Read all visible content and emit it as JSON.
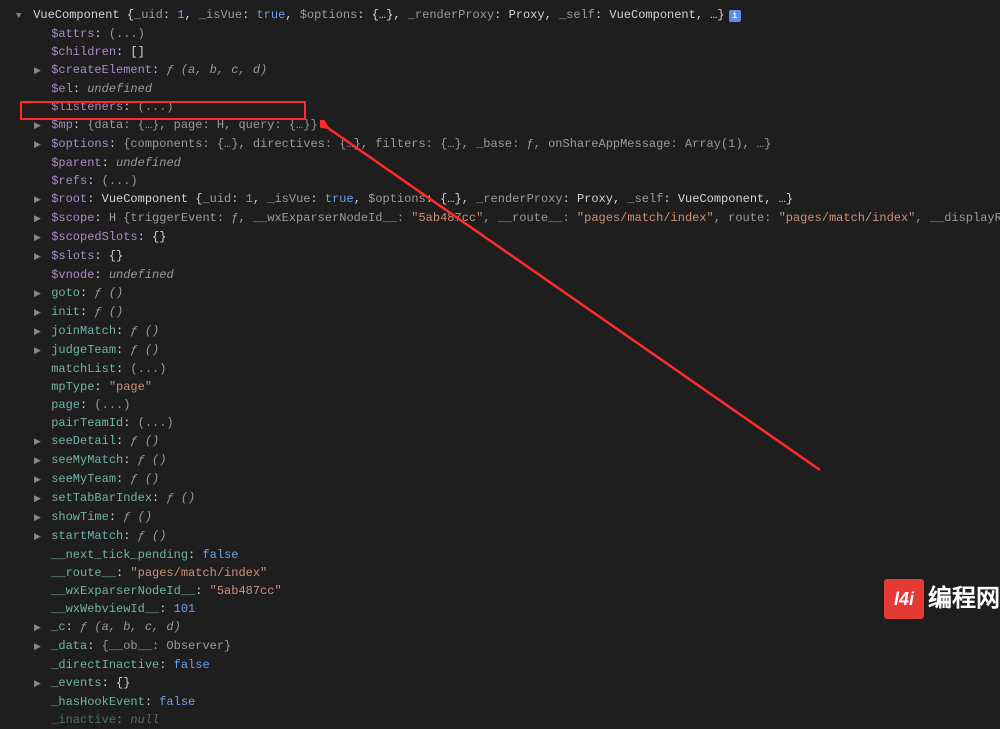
{
  "header": {
    "name": "VueComponent",
    "detail_parts": [
      {
        "k": "_uid",
        "v": "1",
        "t": "num"
      },
      {
        "k": "_isVue",
        "v": "true",
        "t": "bool"
      },
      {
        "k": "$options",
        "v": "{…}",
        "t": "obj"
      },
      {
        "k": "_renderProxy",
        "v": "Proxy",
        "t": "cls"
      },
      {
        "k": "_self",
        "v": "VueComponent",
        "t": "cls"
      }
    ],
    "trail": ", …}"
  },
  "rows": [
    {
      "tri": "none",
      "name": "$attrs",
      "nclass": "prop-purple",
      "val": "(...)",
      "vclass": "gray"
    },
    {
      "tri": "none",
      "name": "$children",
      "nclass": "prop-purple",
      "val": "[]",
      "vclass": "punct"
    },
    {
      "tri": "closed",
      "name": "$createElement",
      "nclass": "prop-purple",
      "fn": "(a, b, c, d)"
    },
    {
      "tri": "none",
      "name": "$el",
      "nclass": "prop-purple",
      "val": "undefined",
      "vclass": "kw-italic"
    },
    {
      "tri": "none",
      "name": "$listeners",
      "nclass": "prop-purple",
      "val": "(...)",
      "vclass": "gray",
      "highlight_cut": true
    },
    {
      "tri": "closed",
      "name": "$mp",
      "nclass": "prop-purple",
      "raw": "{data: {…}, page: H, query: {…}}",
      "highlight": true
    },
    {
      "tri": "closed",
      "name": "$options",
      "nclass": "prop-purple",
      "raw": "{components: {…}, directives: {…}, filters: {…}, _base: ƒ, onShareAppMessage: Array(1), …}"
    },
    {
      "tri": "none",
      "name": "$parent",
      "nclass": "prop-purple",
      "val": "undefined",
      "vclass": "kw-italic"
    },
    {
      "tri": "none",
      "name": "$refs",
      "nclass": "prop-purple",
      "val": "(...)",
      "vclass": "gray"
    },
    {
      "tri": "closed",
      "name": "$root",
      "nclass": "prop-purple",
      "raw_root": true
    },
    {
      "tri": "closed",
      "name": "$scope",
      "nclass": "prop-purple",
      "scope": true
    },
    {
      "tri": "closed",
      "name": "$scopedSlots",
      "nclass": "prop-purple",
      "val": "{}",
      "vclass": "punct"
    },
    {
      "tri": "closed",
      "name": "$slots",
      "nclass": "prop-purple",
      "val": "{}",
      "vclass": "punct"
    },
    {
      "tri": "none",
      "name": "$vnode",
      "nclass": "prop-purple",
      "val": "undefined",
      "vclass": "kw-italic"
    },
    {
      "tri": "closed",
      "name": "goto",
      "nclass": "prop-teal",
      "fn": "()"
    },
    {
      "tri": "closed",
      "name": "init",
      "nclass": "prop-teal",
      "fn": "()"
    },
    {
      "tri": "closed",
      "name": "joinMatch",
      "nclass": "prop-teal",
      "fn": "()"
    },
    {
      "tri": "closed",
      "name": "judgeTeam",
      "nclass": "prop-teal",
      "fn": "()"
    },
    {
      "tri": "none",
      "name": "matchList",
      "nclass": "prop-teal",
      "val": "(...)",
      "vclass": "gray"
    },
    {
      "tri": "none",
      "name": "mpType",
      "nclass": "prop-teal",
      "str": "\"page\""
    },
    {
      "tri": "none",
      "name": "page",
      "nclass": "prop-teal",
      "val": "(...)",
      "vclass": "gray"
    },
    {
      "tri": "none",
      "name": "pairTeamId",
      "nclass": "prop-teal",
      "val": "(...)",
      "vclass": "gray"
    },
    {
      "tri": "closed",
      "name": "seeDetail",
      "nclass": "prop-teal",
      "fn": "()"
    },
    {
      "tri": "closed",
      "name": "seeMyMatch",
      "nclass": "prop-teal",
      "fn": "()"
    },
    {
      "tri": "closed",
      "name": "seeMyTeam",
      "nclass": "prop-teal",
      "fn": "()"
    },
    {
      "tri": "closed",
      "name": "setTabBarIndex",
      "nclass": "prop-teal",
      "fn": "()"
    },
    {
      "tri": "closed",
      "name": "showTime",
      "nclass": "prop-teal",
      "fn": "()"
    },
    {
      "tri": "closed",
      "name": "startMatch",
      "nclass": "prop-teal",
      "fn": "()"
    },
    {
      "tri": "none",
      "name": "__next_tick_pending",
      "nclass": "prop-teal",
      "val": "false",
      "vclass": "val-blue"
    },
    {
      "tri": "none",
      "name": "__route__",
      "nclass": "prop-teal",
      "str": "\"pages/match/index\""
    },
    {
      "tri": "none",
      "name": "__wxExparserNodeId__",
      "nclass": "prop-teal",
      "str": "\"5ab487cc\""
    },
    {
      "tri": "none",
      "name": "__wxWebviewId__",
      "nclass": "prop-teal",
      "val": "101",
      "vclass": "val-blue"
    },
    {
      "tri": "closed",
      "name": "_c",
      "nclass": "prop-teal",
      "fn": "(a, b, c, d)"
    },
    {
      "tri": "closed",
      "name": "_data",
      "nclass": "prop-teal",
      "raw": "{__ob__: Observer}"
    },
    {
      "tri": "none",
      "name": "_directInactive",
      "nclass": "prop-teal",
      "val": "false",
      "vclass": "val-blue"
    },
    {
      "tri": "closed",
      "name": "_events",
      "nclass": "prop-teal",
      "val": "{}",
      "vclass": "punct"
    },
    {
      "tri": "none",
      "name": "_hasHookEvent",
      "nclass": "prop-teal",
      "val": "false",
      "vclass": "val-blue"
    },
    {
      "tri": "none",
      "name": "_inactive",
      "nclass": "prop-teal",
      "val": "null",
      "vclass": "kw-italic",
      "faded": true
    }
  ],
  "scope": {
    "lead": "H {triggerEvent: ƒ, __wxExparserNodeId__: ",
    "s1": "\"5ab487cc\"",
    "mid1": ", __route__: ",
    "s2": "\"pages/match/index\"",
    "mid2": ", route: ",
    "s3": "\"pages/match/index\"",
    "tail": ", __displayReporter: v, …}"
  },
  "watermark": {
    "logo": "l4i",
    "text": "编程网"
  },
  "colors": {
    "highlight_border": "#ff2b2b",
    "arrow": "#ff2b2b"
  }
}
